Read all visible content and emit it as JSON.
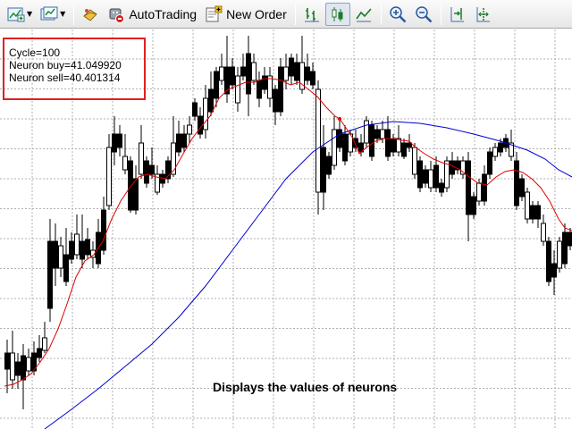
{
  "toolbar": {
    "buttons": [
      {
        "name": "new-chart-button",
        "icon": "new-chart-icon",
        "dropdown": true
      },
      {
        "name": "profiles-button",
        "icon": "profiles-icon",
        "dropdown": true
      },
      {
        "name": "market-watch-button",
        "icon": "market-watch-icon"
      },
      {
        "name": "autotrading-button",
        "icon": "autotrading-icon",
        "label": "AutoTrading"
      },
      {
        "name": "new-order-button",
        "icon": "new-order-icon",
        "label": "New Order"
      },
      {
        "name": "bar-chart-button",
        "icon": "bar-chart-icon"
      },
      {
        "name": "candlestick-chart-button",
        "icon": "candlestick-icon",
        "pressed": true
      },
      {
        "name": "line-chart-button",
        "icon": "line-chart-icon"
      },
      {
        "name": "zoom-in-button",
        "icon": "zoom-in-icon"
      },
      {
        "name": "zoom-out-button",
        "icon": "zoom-out-icon"
      },
      {
        "name": "chart-shift-button",
        "icon": "chart-shift-icon"
      },
      {
        "name": "auto-scroll-button",
        "icon": "auto-scroll-icon"
      }
    ],
    "autotrading_label": "AutoTrading",
    "new_order_label": "New Order"
  },
  "info": {
    "cycle": "Cycle=100",
    "neuron_buy": "Neuron buy=41.049920",
    "neuron_sell": "Neuron sell=40.401314"
  },
  "caption": "Displays the values of neurons",
  "colors": {
    "candle": "#000000",
    "fast_ma": "#e00000",
    "slow_ma": "#0000d0",
    "grid": "#b0b0b0",
    "info_border": "#e02020"
  }
}
